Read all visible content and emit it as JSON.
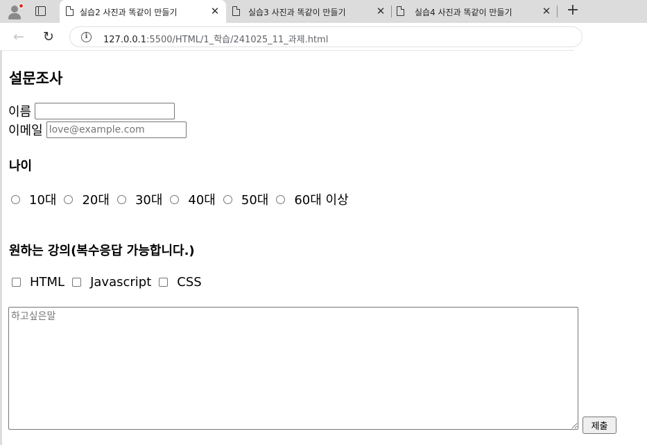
{
  "browser": {
    "tabs": [
      {
        "title": "실습2 사진과 똑같이 만들기",
        "close": "✕",
        "active": true
      },
      {
        "title": "실습3 사진과 똑같이 만들기",
        "close": "✕",
        "active": false
      },
      {
        "title": "실습4 사진과 똑같이 만들기",
        "close": "✕",
        "active": false
      }
    ],
    "new_tab": "+",
    "back": "←",
    "reload": "↻",
    "info": "i",
    "url_host": "127.0.0.1",
    "url_path": ":5500/HTML/1_학습/241025_11_과제.html",
    "profile_badge_color": "#d93025"
  },
  "form": {
    "title": "설문조사",
    "name_label": "이름",
    "name_value": "",
    "email_label": "이메일",
    "email_placeholder": "love@example.com",
    "age_heading": "나이",
    "age_options": [
      "10대",
      "20대",
      "30대",
      "40대",
      "50대",
      "60대 이상"
    ],
    "course_heading": "원하는 강의(복수응답 가능합니다.)",
    "course_options": [
      "HTML",
      "Javascript",
      "CSS"
    ],
    "message_placeholder": "하고싶은말",
    "submit_label": "제출"
  }
}
